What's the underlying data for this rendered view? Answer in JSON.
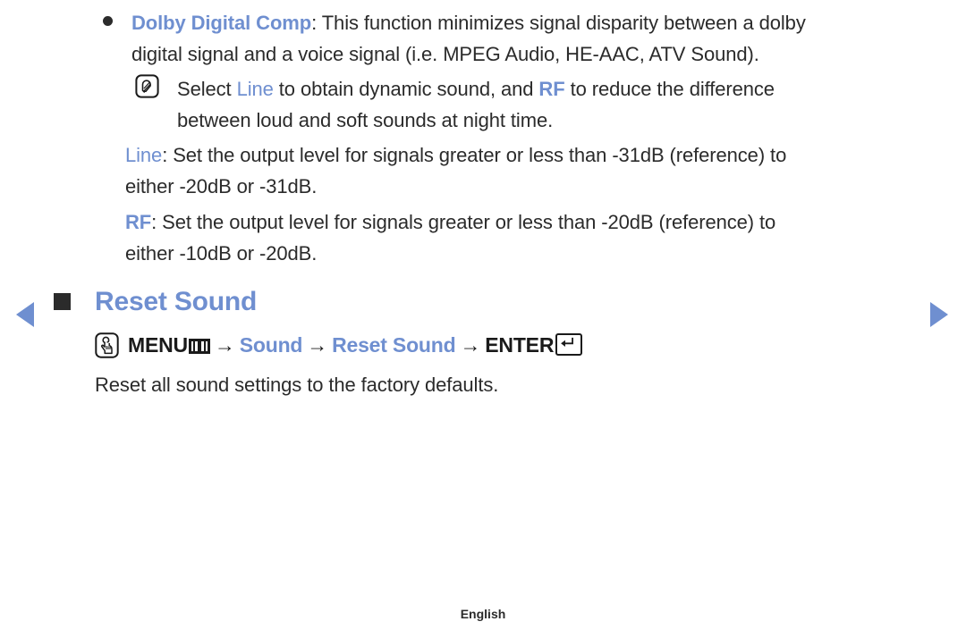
{
  "nav": {
    "prev_label": "previous page",
    "next_label": "next page"
  },
  "bullet_section": {
    "term": "Dolby Digital Comp",
    "line1_rest": ": This function minimizes signal disparity between a dolby",
    "line2": "digital signal and a voice signal (i.e. MPEG Audio, HE-AAC, ATV Sound).",
    "note": {
      "icon": "note-pencil-icon",
      "part1": "Select ",
      "option1": "Line",
      "part2": " to obtain dynamic sound, and ",
      "option2": "RF",
      "part3": " to reduce the difference",
      "line2": "between loud and soft sounds at night time."
    },
    "line_option": {
      "term": "Line",
      "line1_rest": ": Set the output level for signals greater or less than -31dB (reference) to",
      "line2": "either -20dB or -31dB."
    },
    "rf_option": {
      "term": "RF",
      "line1_rest": ": Set the output level for signals greater or less than -20dB (reference) to",
      "line2": "either -10dB or -20dB."
    }
  },
  "section": {
    "marker": "square-bullet-icon",
    "title": "Reset Sound",
    "menu_path": {
      "press_icon": "hand-press-icon",
      "menu_label": "MENU",
      "menu_icon": "menu-bars-icon",
      "arrow1": "→",
      "step1": "Sound",
      "arrow2": "→",
      "step2": "Reset Sound",
      "arrow3": "→",
      "enter_label": "ENTER",
      "enter_icon": "enter-return-icon"
    },
    "description": "Reset all sound settings to the factory defaults."
  },
  "footer": {
    "language": "English"
  },
  "colors": {
    "accent_blue": "#6f8fd0",
    "text": "#2b2b2b",
    "background": "#ffffff"
  }
}
